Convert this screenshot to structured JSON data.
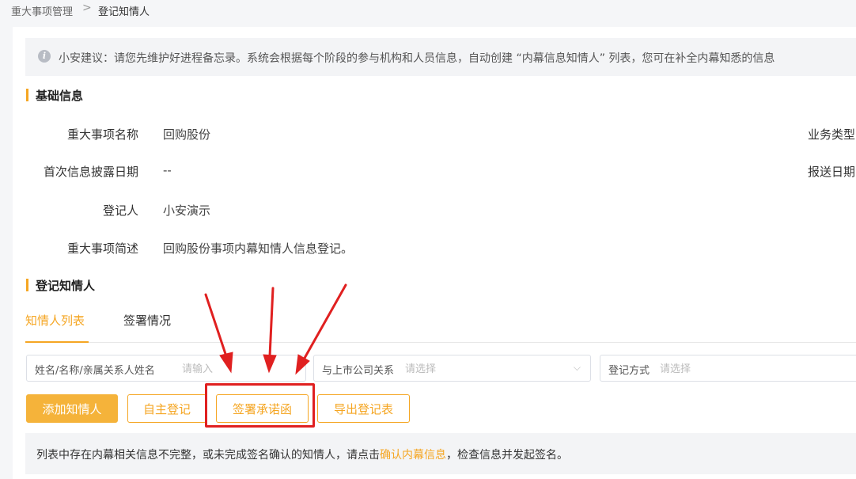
{
  "breadcrumb": {
    "parent": "重大事项管理",
    "separator": ">",
    "current": "登记知情人"
  },
  "tip": {
    "icon": "info-icon",
    "text": "小安建议：请您先维护好进程备忘录。系统会根据每个阶段的参与机构和人员信息，自动创建 “内幕信息知情人” 列表，您可在补全内幕知悉的信息"
  },
  "basic_info": {
    "title": "基础信息",
    "fields": [
      {
        "label": "重大事项名称",
        "value": "回购股份"
      },
      {
        "label": "首次信息披露日期",
        "value": "--"
      },
      {
        "label": "登记人",
        "value": "小安演示"
      },
      {
        "label": "重大事项简述",
        "value": "回购股份事项内幕知情人信息登记。"
      }
    ],
    "right_labels": [
      "业务类型",
      "报送日期"
    ]
  },
  "register": {
    "title": "登记知情人",
    "tabs": [
      {
        "label": "知情人列表",
        "active": true
      },
      {
        "label": "签署情况",
        "active": false
      }
    ],
    "filters": [
      {
        "label": "姓名/名称/亲属关系人姓名",
        "placeholder": "请输入"
      },
      {
        "label": "与上市公司关系",
        "placeholder": "请选择"
      },
      {
        "label": "登记方式",
        "placeholder": "请选择"
      }
    ],
    "buttons": {
      "add": "添加知情人",
      "self_register": "自主登记",
      "sign_letter": "签署承诺函",
      "export": "导出登记表"
    },
    "notice": {
      "before": "列表中存在内幕相关信息不完整，或未完成签名确认的知情人，请点击",
      "link": "确认内幕信息",
      "after": "，检查信息并发起签名。"
    }
  },
  "colors": {
    "accent": "#f5a623",
    "annotation": "#e02020"
  }
}
